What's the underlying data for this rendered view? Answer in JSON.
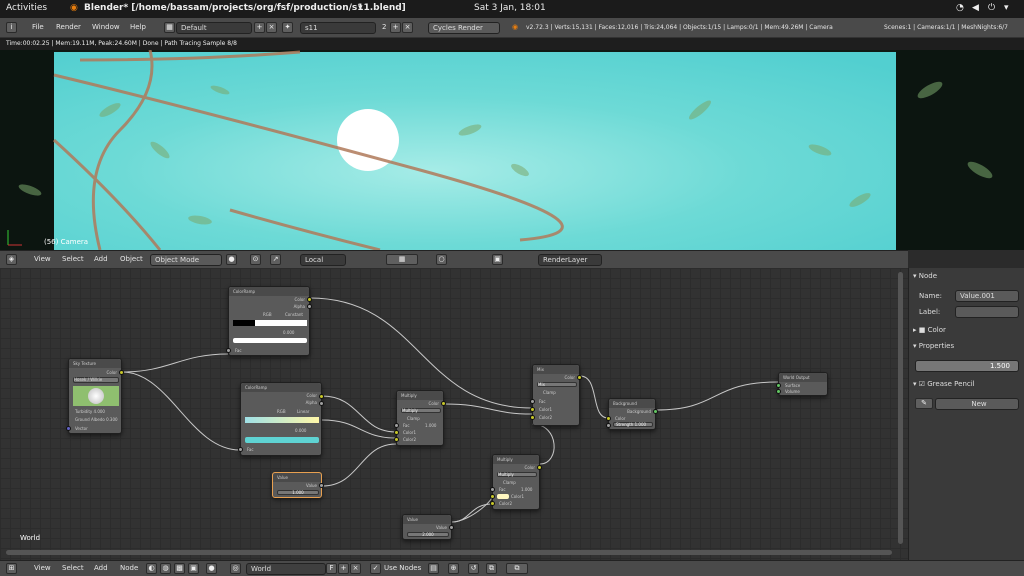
{
  "gnome": {
    "activities": "Activities",
    "title": "Blender* [/home/bassam/projects/org/fsf/production/s11.blend]",
    "clock": "Sat  3 Jan, 18:01"
  },
  "header": {
    "menus": [
      "File",
      "Render",
      "Window",
      "Help"
    ],
    "layout": "Default",
    "scene": "s11",
    "scene_users": "2",
    "engine": "Cycles Render",
    "stats": "v2.72.3 | Verts:15,131 | Faces:12,016 | Tris:24,064 | Objects:1/15 | Lamps:0/1 | Mem:49.26M | Camera",
    "stats_right": "Scenes:1 | Cameras:1/1 | MeshNights:6/7"
  },
  "infobar": "Time:00:02.25 | Mem:19.11M, Peak:24.60M | Done | Path Tracing Sample 8/8",
  "viewport": {
    "camera_label": "(56) Camera"
  },
  "view_header": {
    "menus": [
      "View",
      "Select",
      "Add",
      "Object"
    ],
    "mode": "Object Mode",
    "orientation": "Local",
    "render_layer": "RenderLayer"
  },
  "node_editor": {
    "world_label": "World",
    "nodes": {
      "sky": {
        "title": "Sky Texture",
        "type": "Hosek / Wilkie",
        "rows": [
          "Color",
          "Turbidity  4.000",
          "Ground Albedo  0.300",
          "Vector"
        ]
      },
      "ramp1": {
        "title": "ColorRamp",
        "rows": [
          "Color",
          "Alpha",
          "RGB",
          "Constant",
          "Fac"
        ],
        "fac": "0.000"
      },
      "ramp2": {
        "title": "ColorRamp",
        "rows": [
          "Color",
          "Alpha",
          "RGB",
          "Linear",
          "Fac"
        ],
        "fac": "0.000"
      },
      "value1": {
        "title": "Value",
        "rows": [
          "Value"
        ],
        "value": "1.000"
      },
      "mult1": {
        "title": "Multiply",
        "rows": [
          "Color",
          "Multiply",
          "Clamp",
          "Fac",
          "Color1",
          "Color2"
        ],
        "fac": "1.000"
      },
      "mix": {
        "title": "Mix",
        "rows": [
          "Color",
          "Mix",
          "Clamp",
          "Fac",
          "Color1",
          "Color2"
        ]
      },
      "mult2": {
        "title": "Multiply",
        "rows": [
          "Color",
          "Multiply",
          "Clamp",
          "Fac",
          "Color1",
          "Color2"
        ],
        "fac": "1.000"
      },
      "value2": {
        "title": "Value",
        "rows": [
          "Value"
        ],
        "value": "2.000"
      },
      "bg": {
        "title": "Background",
        "rows": [
          "Background",
          "Color",
          "Strength"
        ],
        "strength": "1.000"
      },
      "out": {
        "title": "World Output",
        "rows": [
          "Surface",
          "Volume"
        ]
      }
    }
  },
  "node_header": {
    "menus": [
      "View",
      "Select",
      "Add",
      "Node"
    ],
    "world_name": "World",
    "world_flag": "F",
    "use_nodes": "Use Nodes"
  },
  "panel": {
    "node_section": "Node",
    "name_label": "Name:",
    "name_value": "Value.001",
    "label_label": "Label:",
    "label_value": "",
    "color_section": "Color",
    "properties_section": "Properties",
    "prop_value": "1.500",
    "grease_section": "Grease Pencil",
    "new_button": "New"
  }
}
